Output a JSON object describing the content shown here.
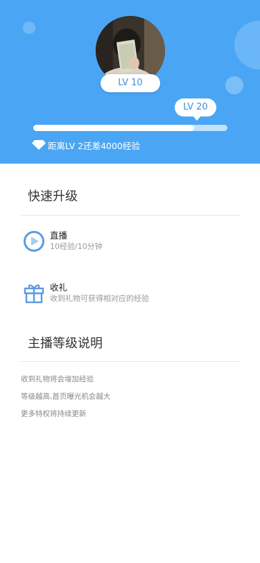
{
  "header": {
    "current_level": "LV 10",
    "next_level": "LV 20",
    "progress": 0.83,
    "exp_message": "距离LV 2还差4000经验",
    "bg_color": "#4aa6f4"
  },
  "quick_upgrade": {
    "title": "快速升级",
    "items": [
      {
        "icon": "play-circle-icon",
        "title": "直播",
        "desc": "10经验/10分钟"
      },
      {
        "icon": "gift-icon",
        "title": "收礼",
        "desc": "收到礼物可获得相对应的经验"
      }
    ]
  },
  "level_info": {
    "title": "主播等级说明",
    "notes": [
      "收到礼物将会增加经验",
      "等级越高,首页曝光机会越大",
      "更多特权将持续更新"
    ]
  },
  "accent_color": "#5b9be0"
}
